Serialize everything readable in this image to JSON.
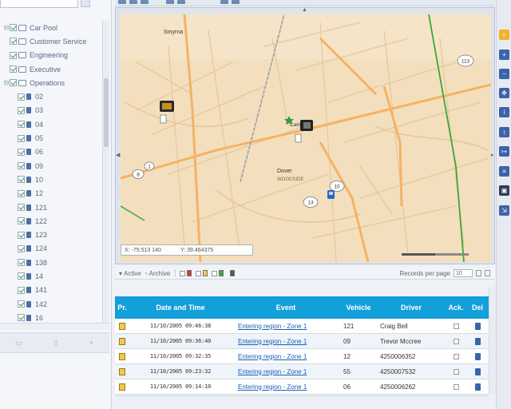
{
  "colors": {
    "grid_header": "#139fda",
    "map_land": "#f3dfbe",
    "road_major": "#f5b266",
    "road_minor": "#e8c79b",
    "rail_line": "#9a9a9a",
    "boundary": "#3aa83a",
    "link": "#1a5fb4",
    "accent_blue": "#3d63a8"
  },
  "sidebar": {
    "tree": [
      {
        "label": "Car Pool",
        "kind": "group",
        "level": 0
      },
      {
        "label": "Customer Service",
        "kind": "group",
        "level": 0
      },
      {
        "label": "Engineering",
        "kind": "group",
        "level": 0
      },
      {
        "label": "Executive",
        "kind": "group",
        "level": 0
      },
      {
        "label": "Operations",
        "kind": "group",
        "level": 0
      },
      {
        "label": "02",
        "kind": "vehicle",
        "level": 1
      },
      {
        "label": "03",
        "kind": "vehicle",
        "level": 1
      },
      {
        "label": "04",
        "kind": "vehicle",
        "level": 1
      },
      {
        "label": "05",
        "kind": "vehicle",
        "level": 1
      },
      {
        "label": "06",
        "kind": "vehicle",
        "level": 1
      },
      {
        "label": "09",
        "kind": "vehicle",
        "level": 1
      },
      {
        "label": "10",
        "kind": "vehicle",
        "level": 1
      },
      {
        "label": "12",
        "kind": "vehicle",
        "level": 1
      },
      {
        "label": "121",
        "kind": "vehicle",
        "level": 1
      },
      {
        "label": "122",
        "kind": "vehicle",
        "level": 1
      },
      {
        "label": "123",
        "kind": "vehicle",
        "level": 1
      },
      {
        "label": "124",
        "kind": "vehicle",
        "level": 1
      },
      {
        "label": "138",
        "kind": "vehicle",
        "level": 1
      },
      {
        "label": "14",
        "kind": "vehicle",
        "level": 1
      },
      {
        "label": "141",
        "kind": "vehicle",
        "level": 1
      },
      {
        "label": "142",
        "kind": "vehicle",
        "level": 1
      },
      {
        "label": "16",
        "kind": "vehicle",
        "level": 1
      }
    ]
  },
  "map": {
    "labels": {
      "top_town": "Smyrna",
      "center_town": "Dover",
      "district": "WOODSIDE",
      "cluster": "Camden",
      "shield_route_a": "113",
      "shield_route_b": "13",
      "shield_route_c": "10",
      "shield_route_d": "8",
      "shield_route_e": "1"
    },
    "coords": {
      "x_label": "X: -75.513 140",
      "y_label": "Y: 39.464375"
    }
  },
  "grid": {
    "toolbar": {
      "active_label": "Active",
      "archive_label": "Archive",
      "records_label": "Records per page",
      "records_value": "10"
    },
    "headers": {
      "priority": "Pr.",
      "datetime": "Date and Time",
      "event": "Event",
      "vehicle": "Vehicle",
      "driver": "Driver",
      "ack": "Ack.",
      "del": "Del"
    },
    "rows": [
      {
        "datetime": "11/10/2005 09:46:38",
        "event": "Entering region - Zone 1",
        "vehicle": "121",
        "driver": "Craig Bell"
      },
      {
        "datetime": "11/10/2005 09:36:40",
        "event": "Entering region - Zone 1",
        "vehicle": "09",
        "driver": "Trevor Mccree"
      },
      {
        "datetime": "11/10/2005 09:32:35",
        "event": "Entering region - Zone 1",
        "vehicle": "12",
        "driver": "4250006352"
      },
      {
        "datetime": "11/10/2005 09:23:32",
        "event": "Entering region - Zone 1",
        "vehicle": "55",
        "driver": "4250007532"
      },
      {
        "datetime": "11/10/2005 09:14:10",
        "event": "Entering region - Zone 1",
        "vehicle": "06",
        "driver": "4250006262"
      }
    ]
  }
}
